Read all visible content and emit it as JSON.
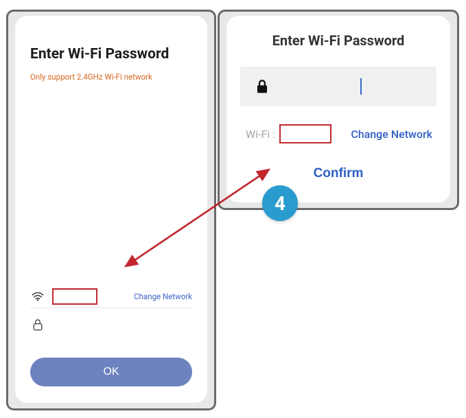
{
  "left": {
    "title": "Enter Wi-Fi Password",
    "subtitle": "Only support 2.4GHz Wi-Fi network",
    "change_network": "Change Network",
    "ok_label": "OK"
  },
  "right": {
    "title": "Enter Wi-Fi Password",
    "wifi_label": "Wi-Fi :",
    "change_network": "Change Network",
    "confirm_label": "Confirm",
    "password_value": ""
  },
  "annotation": {
    "step_number": "4"
  },
  "colors": {
    "accent_blue": "#2f60c4",
    "warn_orange": "#d8641d",
    "highlight_red": "#c1272d",
    "ok_button": "#6d83bf",
    "badge": "#2a9bcf"
  }
}
